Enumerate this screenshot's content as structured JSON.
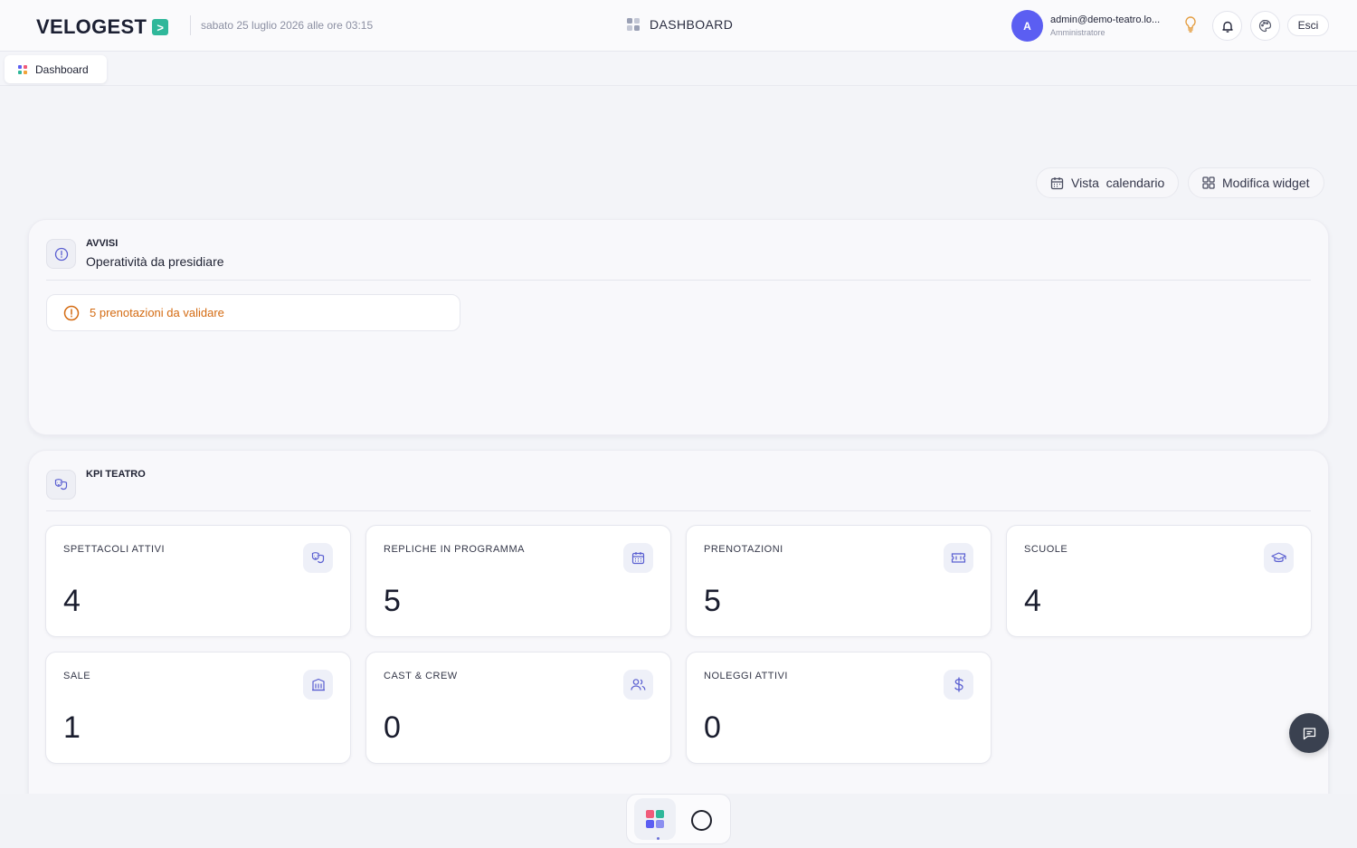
{
  "header": {
    "logo_text": "VELOGEST",
    "logo_badge": ">",
    "datetime": "sabato 25 luglio 2026 alle ore 03:15",
    "page_title": "DASHBOARD",
    "user": {
      "avatar_initial": "A",
      "email": "admin@demo-teatro.lo...",
      "role": "Amministratore"
    },
    "logout_label": "Esci"
  },
  "tabs": [
    {
      "label": "Dashboard",
      "icon": "grid-icon"
    }
  ],
  "actions": {
    "calendar_label": "Vista  calendario",
    "widget_label": "Modifica widget"
  },
  "alerts_panel": {
    "kicker": "AVVISI",
    "title": "Operatività da presidiare",
    "items": [
      {
        "text": "5 prenotazioni da validare",
        "color": "#d46b12"
      }
    ]
  },
  "kpi_panel": {
    "kicker": "KPI TEATRO",
    "cards": [
      {
        "label": "SPETTACOLI ATTIVI",
        "value": "4",
        "icon": "theater-masks-icon"
      },
      {
        "label": "REPLICHE IN PROGRAMMA",
        "value": "5",
        "icon": "calendar-icon"
      },
      {
        "label": "PRENOTAZIONI",
        "value": "5",
        "icon": "ticket-icon"
      },
      {
        "label": "SCUOLE",
        "value": "4",
        "icon": "graduation-cap-icon"
      },
      {
        "label": "SALE",
        "value": "1",
        "icon": "building-icon"
      },
      {
        "label": "CAST & CREW",
        "value": "0",
        "icon": "users-icon"
      },
      {
        "label": "NOLEGGI ATTIVI",
        "value": "0",
        "icon": "dollar-icon"
      }
    ]
  },
  "colors": {
    "accent": "#5b5ef2",
    "icon_accent": "#5a5fd1",
    "warning": "#d46b12",
    "brand_green": "#2fb79a"
  }
}
